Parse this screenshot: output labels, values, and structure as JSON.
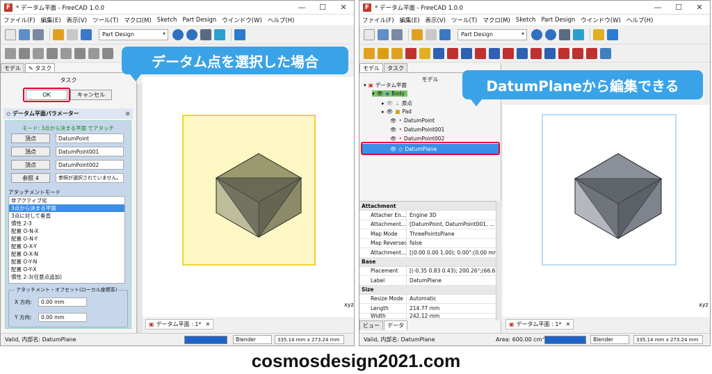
{
  "left": {
    "title": "* データム平面 - FreeCAD 1.0.0",
    "menu": [
      "ファイル(F)",
      "編集(E)",
      "表示(V)",
      "ツール(T)",
      "マクロ(M)",
      "Sketch",
      "Part Design",
      "ウインドウ(W)",
      "ヘルプ(H)"
    ],
    "workbench": "Part Design",
    "banner": "データム点を選択した場合",
    "tabs": [
      "モデル",
      "タスク"
    ],
    "task_title": "タスク",
    "ok": "OK",
    "cancel": "キャンセル",
    "params_title": "データム平面パラメーター",
    "mode_line": "モード: 3点から決まる平面 でアタッチ",
    "refs": [
      {
        "btn": "頂点",
        "val": "DatumPoint"
      },
      {
        "btn": "頂点",
        "val": "DatumPoint001"
      },
      {
        "btn": "頂点",
        "val": "DatumPoint002"
      },
      {
        "btn": "参照 4",
        "val": "参照が選択されていません。"
      }
    ],
    "attach_mode_label": "アタッチメントモード",
    "modes": [
      "非アクティブ化",
      "3点から決まる平面",
      "3点に対して垂直",
      "慣性 2-3",
      "配置 O-N-X",
      "配置 O-N-Y",
      "配置 O-X-Y",
      "配置 O-X-N",
      "配置 O-Y-N",
      "配置 O-Y-X",
      "慣性 2-3(任意点追加)"
    ],
    "selected_mode": 1,
    "offset_label": "アタッチメント・オフセット(ローカル座標系)",
    "offsets": [
      {
        "lab": "X 方向:",
        "val": "0.00 mm"
      },
      {
        "lab": "Y 方向:",
        "val": "0.00 mm"
      }
    ],
    "doc_tab": "データム平面 : 1*",
    "status": "Valid, 内部名: DatumPlane",
    "nav": "Blender",
    "dims": "335.14 mm x 273.24 mm"
  },
  "right": {
    "title": "* データム平面 - FreeCAD 1.0.0",
    "menu": [
      "ファイル(F)",
      "編集(E)",
      "表示(V)",
      "ツール(T)",
      "マクロ(M)",
      "Sketch",
      "Part Design",
      "ウインドウ(W)",
      "ヘルプ(H)"
    ],
    "workbench": "Part Design",
    "banner": "DatumPlaneから編集できる",
    "tabs": [
      "モデル",
      "タスク"
    ],
    "tree_title": "モデル",
    "tree": [
      "データム平面",
      "Body",
      "原点",
      "Pad",
      "DatumPoint",
      "DatumPoint001",
      "DatumPoint002",
      "DatumPlane"
    ],
    "props": {
      "g1": "Attachment",
      "attach": [
        {
          "k": "Attacher En...",
          "v": "Engine 3D"
        },
        {
          "k": "Attachment...",
          "v": "[DatumPoint, DatumPoint001, ..."
        },
        {
          "k": "Map Mode",
          "v": "ThreePointsPlane"
        },
        {
          "k": "Map Reversed",
          "v": "false"
        },
        {
          "k": "Attachment...",
          "v": "[(0.00 0.00 1.00); 0.00°;(0.00 mm..."
        }
      ],
      "g2": "Base",
      "base": [
        {
          "k": "Placement",
          "v": "[(-0.35 0.83 0.43); 200.26°;(66.67..."
        },
        {
          "k": "Label",
          "v": "DatumPlane"
        }
      ],
      "g3": "Size",
      "size": [
        {
          "k": "Resize Mode",
          "v": "Automatic"
        },
        {
          "k": "Length",
          "v": "214.77 mm"
        },
        {
          "k": "Width",
          "v": "242.12 mm"
        }
      ]
    },
    "bottom_tabs": [
      "ビュー",
      "データ"
    ],
    "doc_tab": "データム平面 : 1*",
    "status": "Valid, 内部名: DatumPlane",
    "area": "Area: 600.00 cm^2",
    "nav": "Blender",
    "dims": "335.14 mm x 273.24 mm"
  },
  "footer": "cosmosdesign2021.com"
}
